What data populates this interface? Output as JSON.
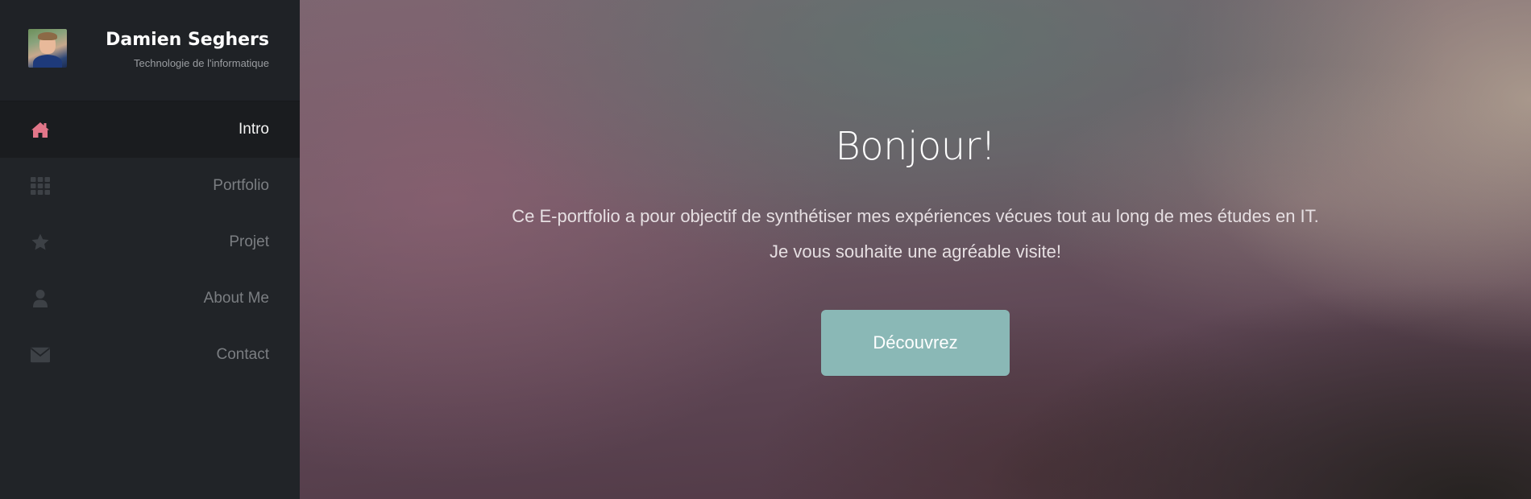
{
  "profile": {
    "name": "Damien Seghers",
    "subtitle": "Technologie de l'informatique"
  },
  "nav": {
    "items": [
      {
        "label": "Intro",
        "icon": "home-icon",
        "active": true
      },
      {
        "label": "Portfolio",
        "icon": "grid-icon",
        "active": false
      },
      {
        "label": "Projet",
        "icon": "star-icon",
        "active": false
      },
      {
        "label": "About Me",
        "icon": "user-icon",
        "active": false
      },
      {
        "label": "Contact",
        "icon": "envelope-icon",
        "active": false
      }
    ]
  },
  "hero": {
    "title": "Bonjour!",
    "line1": "Ce E-portfolio a pour objectif de synthétiser mes expériences vécues tout au long de mes études en IT.",
    "line2": "Je vous souhaite une agréable visite!",
    "button_label": "Découvrez"
  },
  "colors": {
    "sidebar_bg": "#212428",
    "active_icon": "#e27689",
    "inactive_icon": "#3d4146",
    "button_bg": "#8ab8b6"
  }
}
